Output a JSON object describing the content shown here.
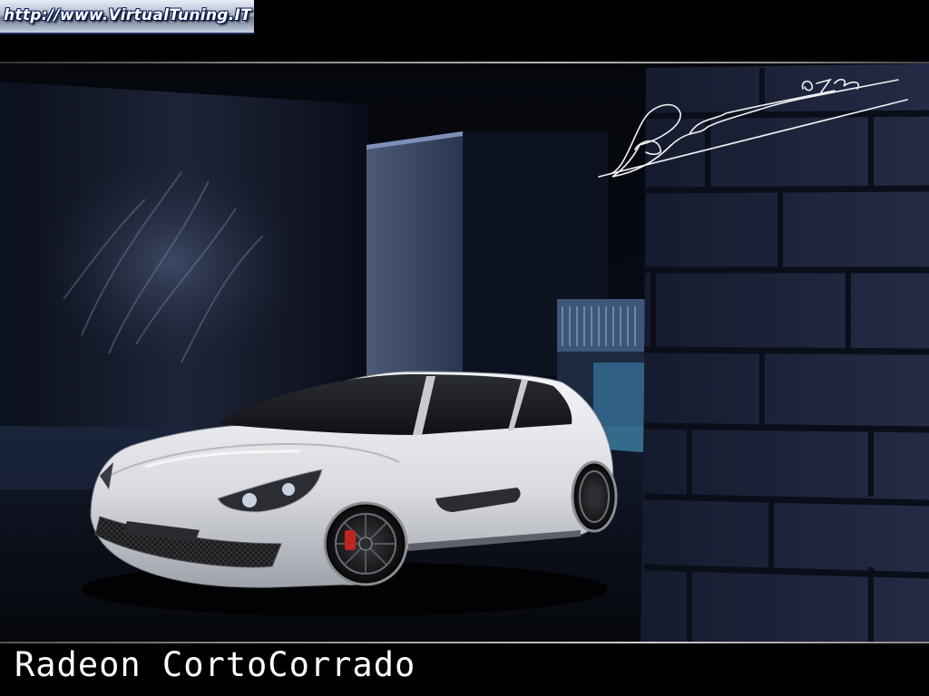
{
  "banner": {
    "url_text": "http://www.VirtualTuning.IT"
  },
  "artwork": {
    "signature": "Radeon 67m",
    "subject": "white three-door concept hatchback in dark alley at night"
  },
  "caption": {
    "title": "Radeon CortoCorrado"
  },
  "colors": {
    "background": "#000000",
    "wall_blue": "#1b2238",
    "car_body": "#e6e7ea",
    "caption_text": "#ffffff",
    "banner_text_outline": "#0a1a55"
  }
}
